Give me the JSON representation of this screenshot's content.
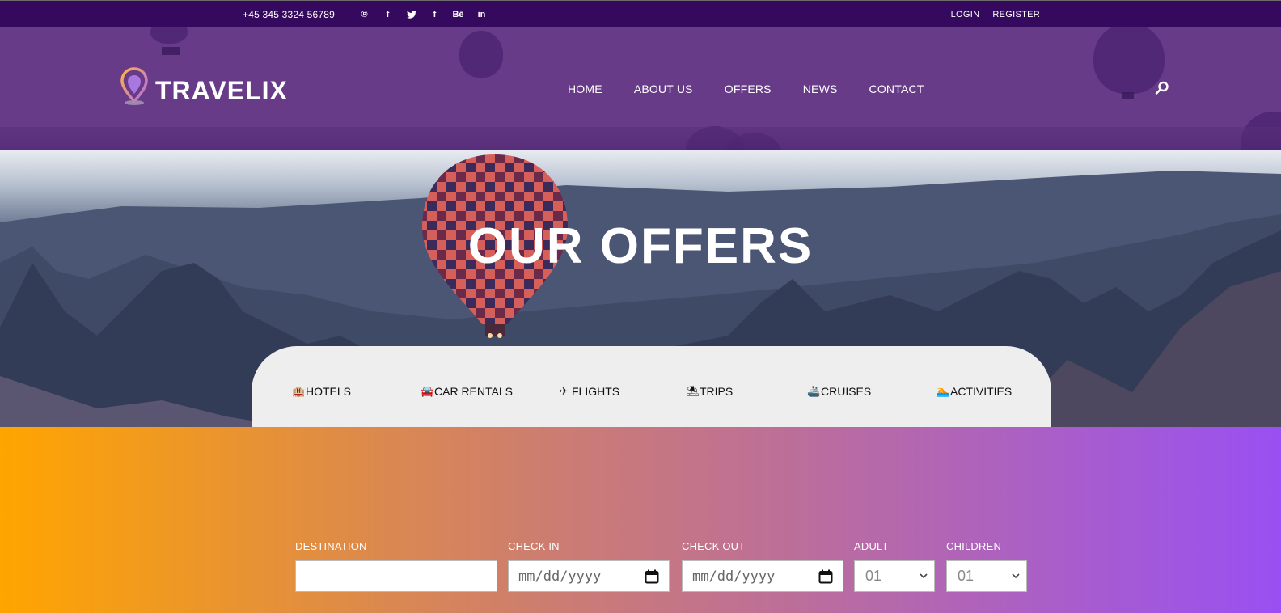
{
  "topbar": {
    "phone": "+45 345 3324 56789",
    "socials": [
      {
        "icon": "pinterest-icon",
        "glyph": "℗"
      },
      {
        "icon": "facebook-icon",
        "glyph": "f"
      },
      {
        "icon": "twitter-icon",
        "glyph": "🐦"
      },
      {
        "icon": "facebook-icon-2",
        "glyph": "f"
      },
      {
        "icon": "behance-icon",
        "glyph": "Bē"
      },
      {
        "icon": "linkedin-icon",
        "glyph": "in"
      }
    ],
    "login": "LOGIN",
    "register": "REGISTER"
  },
  "header": {
    "logo_text": "TRAVELIX",
    "nav": [
      "HOME",
      "ABOUT US",
      "OFFERS",
      "NEWS",
      "CONTACT"
    ]
  },
  "hero": {
    "title": "OUR OFFERS"
  },
  "tabs": [
    {
      "label": "HOTELS",
      "icon": "hotel-icon",
      "glyph": "🏨"
    },
    {
      "label": "CAR RENTALS",
      "icon": "car-icon",
      "glyph": "🚘"
    },
    {
      "label": "FLIGHTS",
      "icon": "plane-icon",
      "glyph": "✈"
    },
    {
      "label": "TRIPS",
      "icon": "beach-icon",
      "glyph": "⛱"
    },
    {
      "label": "CRUISES",
      "icon": "ship-icon",
      "glyph": "🚢"
    },
    {
      "label": "ACTIVITIES",
      "icon": "swim-icon",
      "glyph": "🏊"
    }
  ],
  "search": {
    "destination_label": "DESTINATION",
    "destination_value": "",
    "checkin_label": "CHECK IN",
    "checkin_placeholder": "mm/dd/yyyy",
    "checkout_label": "CHECK OUT",
    "checkout_placeholder": "mm/dd/yyyy",
    "adult_label": "ADULT",
    "adult_value": "01",
    "children_label": "CHILDREN",
    "children_value": "01"
  },
  "colors": {
    "topbar": "#350a5e",
    "header": "#683b89",
    "gradient_start": "#ffa500",
    "gradient_end": "#9950f2"
  }
}
